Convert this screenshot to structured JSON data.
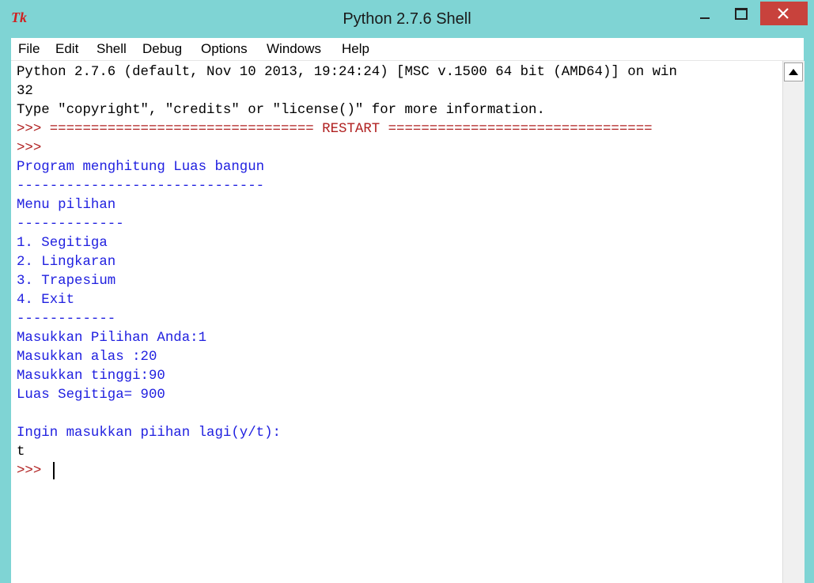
{
  "window": {
    "title": "Python 2.7.6 Shell",
    "icon": "Tk"
  },
  "menu": [
    "File",
    "Edit",
    "Shell",
    "Debug",
    "Options",
    "Windows",
    "Help"
  ],
  "shell": {
    "lines": [
      {
        "text": "Python 2.7.6 (default, Nov 10 2013, 19:24:24) [MSC v.1500 64 bit (AMD64)] on win",
        "color": "black"
      },
      {
        "text": "32",
        "color": "black"
      },
      {
        "text": "Type \"copyright\", \"credits\" or \"license()\" for more information.",
        "color": "black"
      },
      {
        "text": "",
        "color": "black"
      },
      {
        "text": "",
        "color": "black"
      },
      {
        "text": "Program menghitung Luas bangun",
        "color": "blue"
      },
      {
        "text": "------------------------------",
        "color": "blue"
      },
      {
        "text": "Menu pilihan",
        "color": "blue"
      },
      {
        "text": "-------------",
        "color": "blue"
      },
      {
        "text": "1. Segitiga",
        "color": "blue"
      },
      {
        "text": "2. Lingkaran",
        "color": "blue"
      },
      {
        "text": "3. Trapesium",
        "color": "blue"
      },
      {
        "text": "4. Exit",
        "color": "blue"
      },
      {
        "text": "------------",
        "color": "blue"
      },
      {
        "text": "Masukkan Pilihan Anda:1",
        "color": "blue"
      },
      {
        "text": "Masukkan alas :20",
        "color": "blue"
      },
      {
        "text": "Masukkan tinggi:90",
        "color": "blue"
      },
      {
        "text": "Luas Segitiga= 900",
        "color": "blue"
      },
      {
        "text": "",
        "color": "blue"
      },
      {
        "text": "Ingin masukkan piihan lagi(y/t):",
        "color": "blue"
      },
      {
        "text": "t",
        "color": "black"
      },
      {
        "text": "",
        "color": "black"
      }
    ],
    "restart_line": ">>> ================================ RESTART ================================",
    "prompt": ">>>",
    "colors": {
      "black": "#000000",
      "blue": "#2121e0",
      "prompt": "#b02020"
    }
  }
}
